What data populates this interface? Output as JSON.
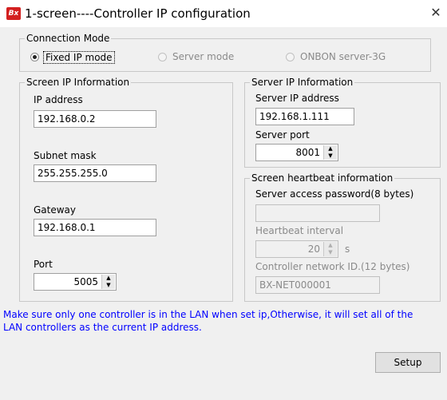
{
  "window": {
    "title": "1-screen----Controller IP configuration",
    "icon_text": "Bx",
    "close_glyph": "✕"
  },
  "connection_mode": {
    "legend": "Connection Mode",
    "options": [
      {
        "label": "Fixed IP mode",
        "selected": true,
        "enabled": true
      },
      {
        "label": "Server mode",
        "selected": false,
        "enabled": false
      },
      {
        "label": "ONBON server-3G",
        "selected": false,
        "enabled": false
      }
    ]
  },
  "screen_ip": {
    "legend": "Screen IP Information",
    "ip_label": "IP address",
    "ip_value": "192.168.0.2",
    "subnet_label": "Subnet mask",
    "subnet_value": "255.255.255.0",
    "gateway_label": "Gateway",
    "gateway_value": "192.168.0.1",
    "port_label": "Port",
    "port_value": "5005"
  },
  "server_ip": {
    "legend": "Server IP Information",
    "ip_label": "Server IP address",
    "ip_value": "192.168.1.111",
    "port_label": "Server port",
    "port_value": "8001"
  },
  "heartbeat": {
    "legend": "Screen heartbeat information",
    "password_label": "Server access password(8 bytes)",
    "password_value": "",
    "interval_label": "Heartbeat interval",
    "interval_value": "20",
    "interval_unit": "s",
    "network_id_label": "Controller network ID.(12 bytes)",
    "network_id_value": "BX-NET000001"
  },
  "notice": "Make sure only one controller is in the LAN when set ip,Otherwise, it will set all of the LAN controllers as the current IP address.",
  "setup_button": "Setup",
  "colors": {
    "notice": "#0000ff",
    "icon_bg": "#d32020",
    "disabled_text": "#8a8a8a"
  }
}
